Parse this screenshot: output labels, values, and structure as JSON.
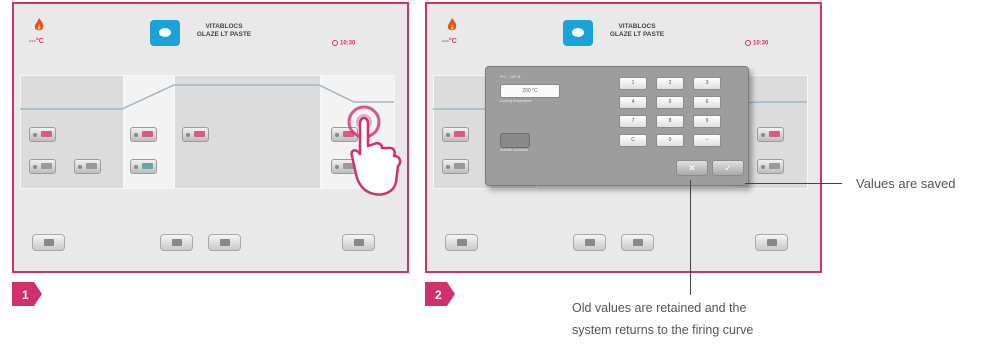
{
  "screen": {
    "temperature": "---°C",
    "program_line1": "VITABLOCS",
    "program_line2": "GLAZE LT PASTE",
    "time": "10:30"
  },
  "numpad": {
    "title": "Pr1 - 100 B",
    "value": "200 °C",
    "value_caption": "Cooling temperature",
    "toggle_caption": "Activate cooldown",
    "keys": [
      "1",
      "2",
      "3",
      "4",
      "5",
      "6",
      "7",
      "8",
      "9",
      "C",
      "0",
      "–"
    ]
  },
  "steps": {
    "one": "1",
    "two": "2"
  },
  "callouts": {
    "saved": "Values are saved",
    "retained_line1": "Old values are retained and the",
    "retained_line2": "system returns to the firing curve"
  },
  "colors": {
    "accent": "#d22f6e",
    "program_icon": "#1aa3d9"
  },
  "icons": [
    "flame-icon",
    "tooth-icon",
    "clock-icon",
    "save-icon",
    "play-icon",
    "back-icon",
    "export-icon",
    "cancel-icon",
    "confirm-icon",
    "pointing-hand-icon"
  ]
}
